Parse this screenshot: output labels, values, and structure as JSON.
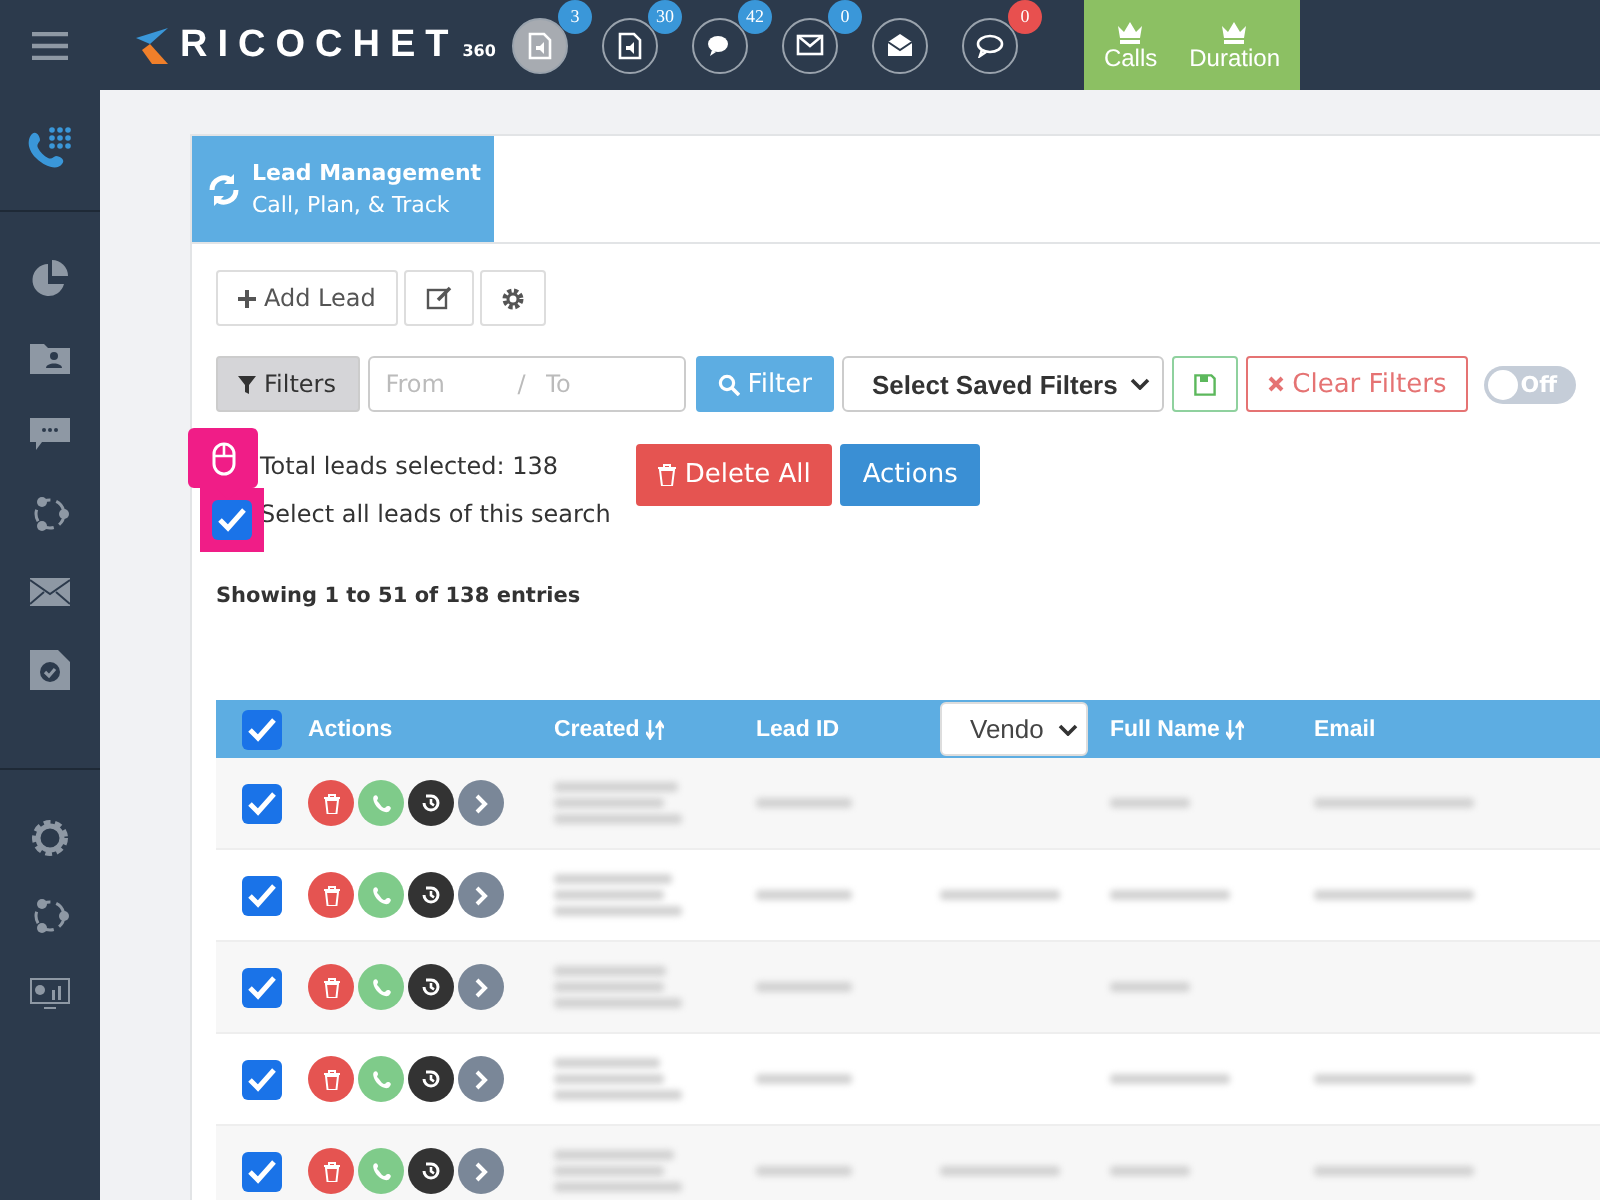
{
  "topbar": {
    "logo": "RICOCHET",
    "logo_sup": "360",
    "notifications": [
      {
        "active": true,
        "count": "3",
        "color": "#3a97d9"
      },
      {
        "active": false,
        "count": "30",
        "color": "#3a97d9"
      },
      {
        "active": false,
        "count": "42",
        "color": "#3a97d9"
      },
      {
        "active": false,
        "count": "0",
        "color": "#3a97d9"
      },
      {
        "active": false
      },
      {
        "active": false,
        "count": "0",
        "color": "#e8504f"
      }
    ],
    "stats": [
      "Calls",
      "Duration"
    ]
  },
  "sidebar": {
    "items": [
      {
        "selected": true
      },
      {
        "selected": false
      },
      {
        "selected": false
      },
      {
        "selected": false
      },
      {
        "selected": false
      },
      {
        "selected": false
      },
      {
        "selected": false
      },
      {
        "selected": false
      },
      {
        "selected": false
      },
      {
        "selected": false
      }
    ]
  },
  "header": {
    "title": "Lead Management",
    "subtitle": "Call, Plan, & Track"
  },
  "toolbar": {
    "add": "Add Lead"
  },
  "filters": {
    "button": "Filters",
    "from_placeholder": "From",
    "separator": "/",
    "to_placeholder": "To",
    "filter": "Filter",
    "saved": "Select Saved Filters",
    "clear": "Clear Filters",
    "toggle": {
      "label": "Off",
      "on": false
    }
  },
  "selection": {
    "total": "Total leads selected: 138",
    "select_all": "Select all leads of this search",
    "checked": true,
    "delete_all": "Delete All",
    "actions": "Actions"
  },
  "showing": "Showing 1 to 51 of 138 entries",
  "table": {
    "all_checked": true,
    "columns": [
      {
        "kind": "text",
        "label": "Actions"
      },
      {
        "kind": "sort",
        "label": "Created"
      },
      {
        "kind": "text",
        "label": "Lead ID"
      },
      {
        "kind": "select",
        "label": "Vendo"
      },
      {
        "kind": "sort",
        "label": "Full Name"
      },
      {
        "kind": "text",
        "label": "Email"
      }
    ],
    "rows": [
      {
        "checked": true
      },
      {
        "checked": true
      },
      {
        "checked": true
      },
      {
        "checked": true
      },
      {
        "checked": true
      }
    ]
  }
}
